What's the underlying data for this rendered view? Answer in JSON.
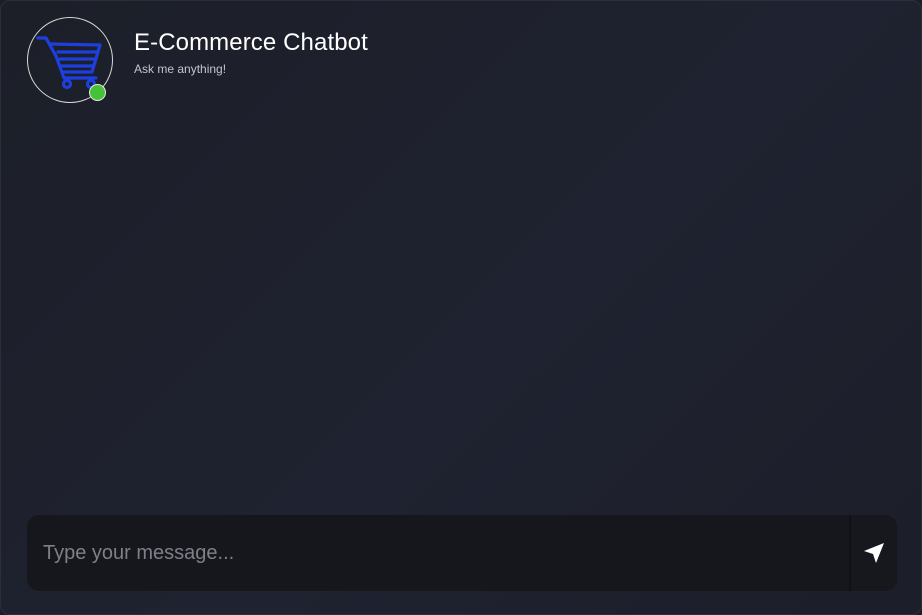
{
  "header": {
    "title": "E-Commerce Chatbot",
    "subtitle": "Ask me anything!",
    "avatar_icon": "shopping-cart-icon",
    "status": "online",
    "status_color": "#45c238",
    "cart_color": "#1e3fe0"
  },
  "composer": {
    "placeholder": "Type your message...",
    "value": "",
    "send_icon": "send-arrow-icon"
  },
  "messages": []
}
